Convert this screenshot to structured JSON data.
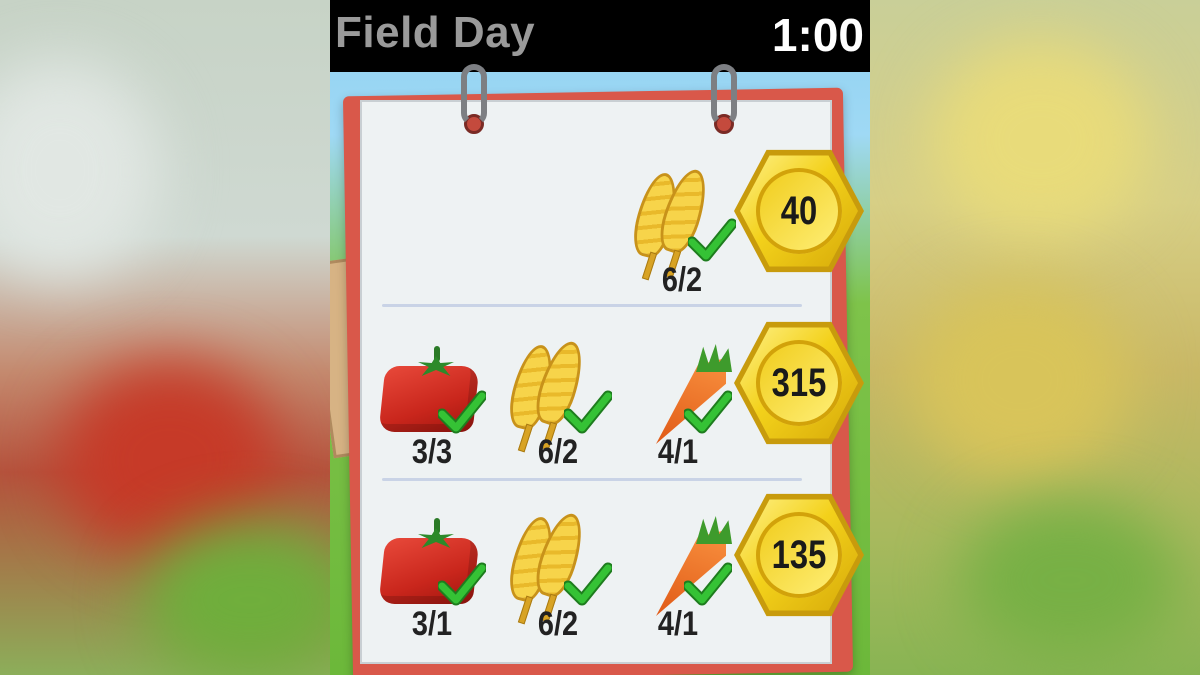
{
  "status_bar": {
    "app_title": "Field Day",
    "time": "1:00"
  },
  "orders": [
    {
      "items": [
        {
          "crop": "wheat",
          "count": "6/2",
          "complete": true
        }
      ],
      "reward": "40"
    },
    {
      "items": [
        {
          "crop": "tomato",
          "count": "3/3",
          "complete": true
        },
        {
          "crop": "wheat",
          "count": "6/2",
          "complete": true
        },
        {
          "crop": "carrot",
          "count": "4/1",
          "complete": true
        }
      ],
      "reward": "315"
    },
    {
      "items": [
        {
          "crop": "tomato",
          "count": "3/1",
          "complete": true
        },
        {
          "crop": "wheat",
          "count": "6/2",
          "complete": true
        },
        {
          "crop": "carrot",
          "count": "4/1",
          "complete": true
        }
      ],
      "reward": "135"
    }
  ],
  "icons": [
    "tomato-icon",
    "wheat-icon",
    "carrot-icon",
    "checkmark-icon",
    "gold-coin-icon"
  ],
  "colors": {
    "pad_border": "#d9584a",
    "check": "#2bb52b",
    "coin_gold": "#f3d11b"
  }
}
